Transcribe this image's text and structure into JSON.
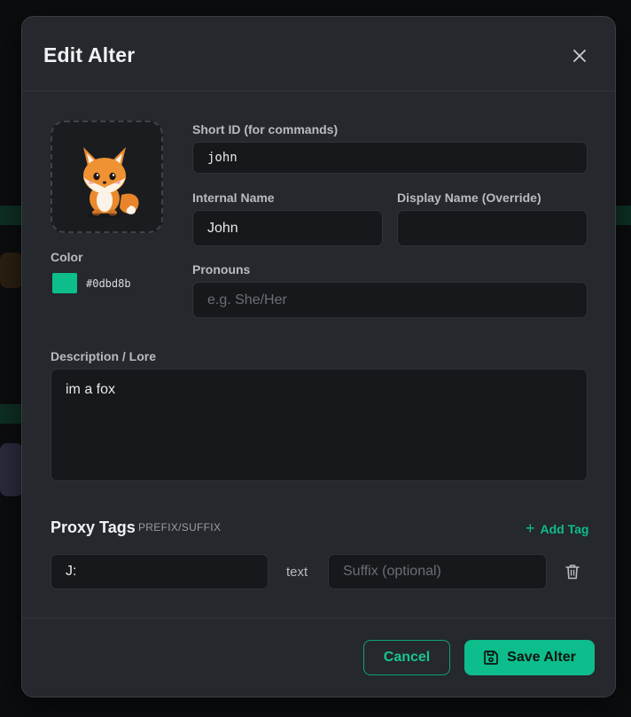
{
  "modal": {
    "title": "Edit Alter"
  },
  "avatar": {
    "icon": "fox-avatar-icon"
  },
  "color": {
    "label": "Color",
    "value": "#0dbd8b"
  },
  "fields": {
    "short_id": {
      "label": "Short ID (for commands)",
      "value": "john"
    },
    "internal_name": {
      "label": "Internal Name",
      "value": "John"
    },
    "display_name": {
      "label": "Display Name (Override)",
      "value": ""
    },
    "pronouns": {
      "label": "Pronouns",
      "value": "",
      "placeholder": "e.g. She/Her"
    },
    "description": {
      "label": "Description / Lore",
      "value": "im a fox"
    }
  },
  "proxy_tags": {
    "title": "Proxy Tags",
    "subtitle": "PREFIX/SUFFIX",
    "add_label": "Add Tag",
    "rows": [
      {
        "prefix": "J:",
        "separator": "text",
        "suffix": "",
        "suffix_placeholder": "Suffix (optional)"
      }
    ]
  },
  "actions": {
    "cancel_label": "Cancel",
    "save_label": "Save Alter"
  },
  "colors": {
    "accent": "#0dbd8b",
    "modal_bg": "#25282d",
    "input_bg": "#17181b"
  }
}
